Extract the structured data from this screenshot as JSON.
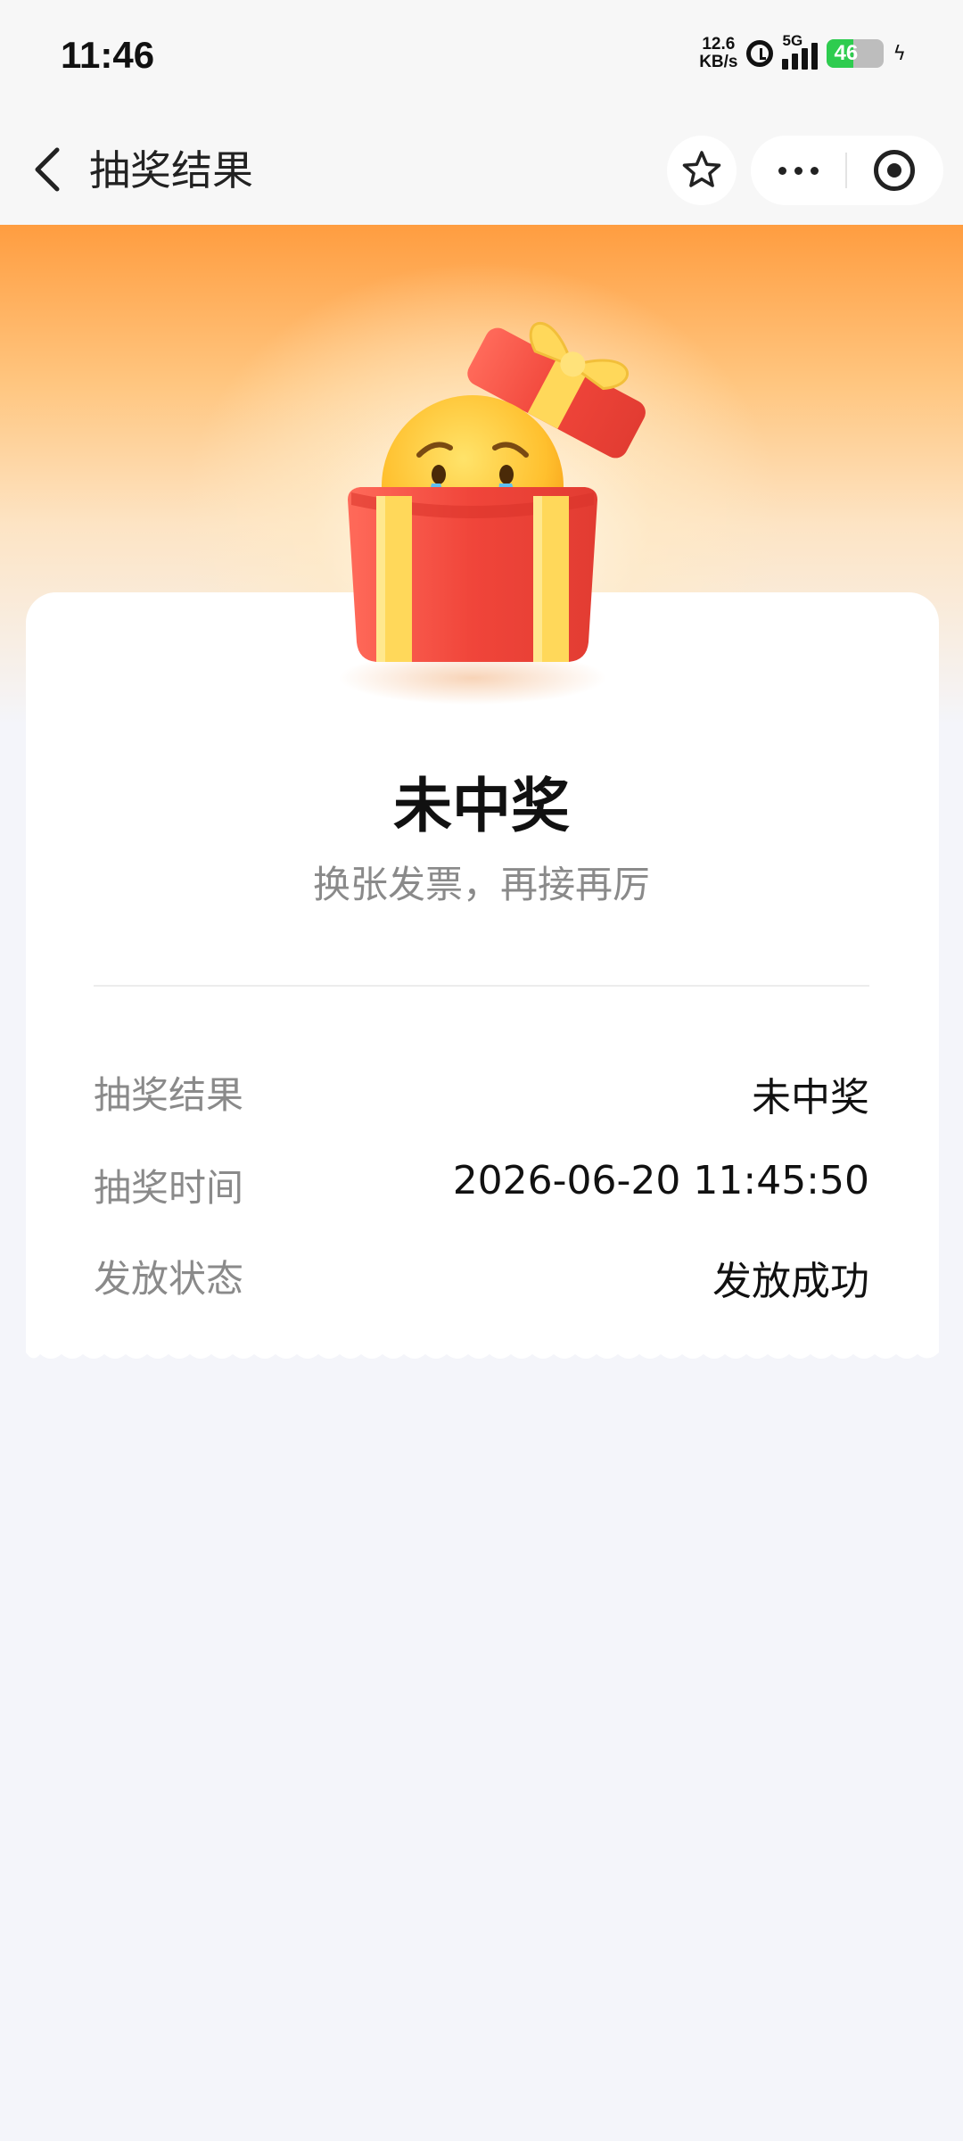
{
  "status": {
    "time": "11:46",
    "net_speed_value": "12.6",
    "net_speed_unit": "KB/s",
    "network_type": "5G",
    "battery_level": "46"
  },
  "nav": {
    "title": "抽奖结果"
  },
  "result": {
    "title": "未中奖",
    "subtitle": "换张发票，再接再厉"
  },
  "details": [
    {
      "label": "抽奖结果",
      "value": "未中奖"
    },
    {
      "label": "抽奖时间",
      "value": "2026-06-20 11:45:50"
    },
    {
      "label": "发放状态",
      "value": "发放成功"
    }
  ],
  "colors": {
    "accent_orange": "#ff9d40",
    "gift_red": "#f0453a",
    "ribbon_yellow": "#ffd85a",
    "background": "#f4f5fa"
  }
}
